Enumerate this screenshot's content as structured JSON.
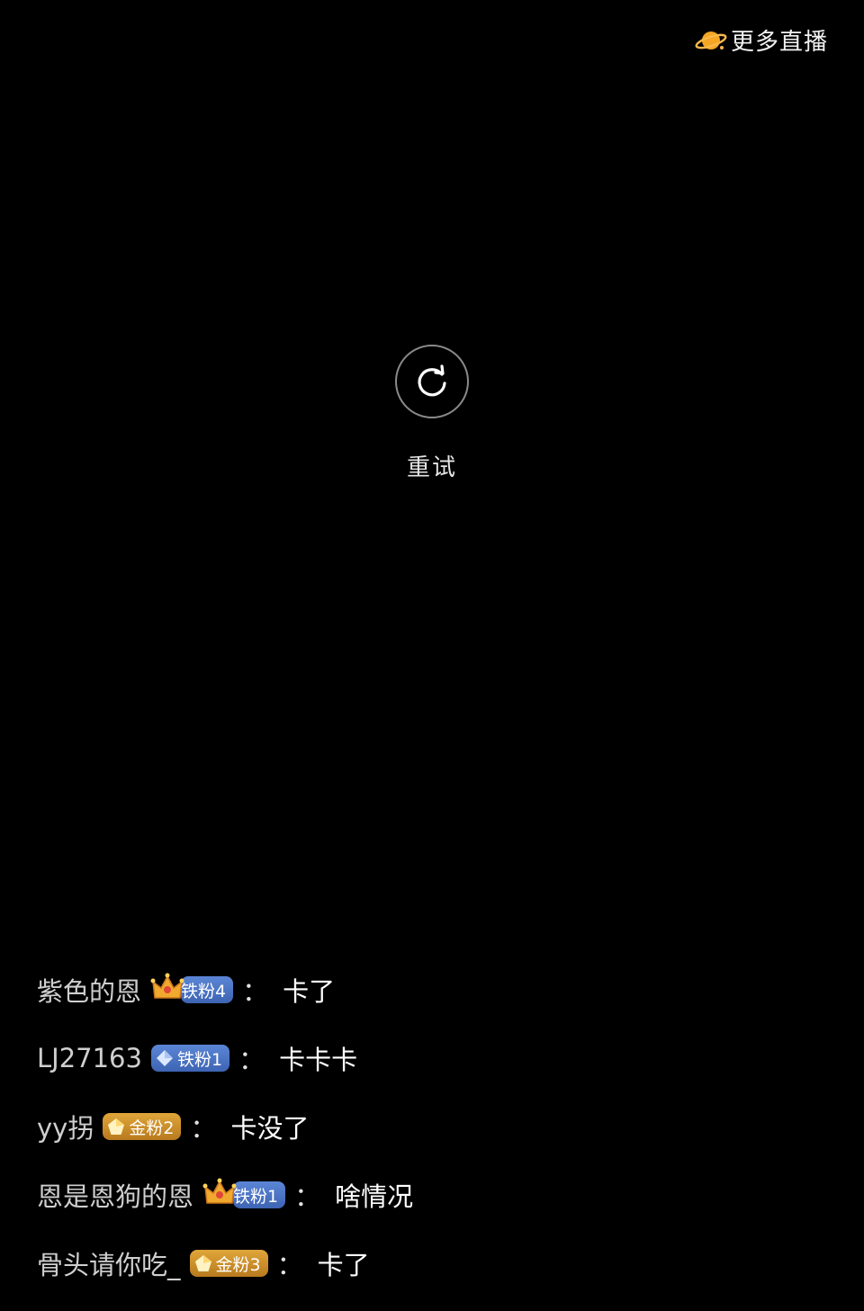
{
  "header": {
    "more_live_label": "更多直播",
    "more_live_icon": "planet-icon"
  },
  "player": {
    "retry_icon": "refresh-icon",
    "retry_label": "重试"
  },
  "chat": {
    "messages": [
      {
        "username": "紫色的恩",
        "badge_type": "iron",
        "badge_icon": "crown-icon",
        "badge_label": "铁粉4",
        "colon": "：",
        "text": "卡了"
      },
      {
        "username": "LJ27163",
        "badge_type": "iron",
        "badge_icon": "diamond-icon",
        "badge_label": "铁粉1",
        "colon": "：",
        "text": "卡卡卡"
      },
      {
        "username": "yy拐",
        "badge_type": "gold",
        "badge_icon": "pentagon-gem-icon",
        "badge_label": "金粉2",
        "colon": "：",
        "text": "卡没了"
      },
      {
        "username": "恩是恩狗的恩",
        "badge_type": "iron",
        "badge_icon": "crown-icon",
        "badge_label": "铁粉1",
        "colon": "：",
        "text": "啥情况"
      },
      {
        "username": "骨头请你吃_",
        "badge_type": "gold",
        "badge_icon": "pentagon-gem-icon",
        "badge_label": "金粉3",
        "colon": "：",
        "text": "卡了"
      }
    ]
  },
  "colors": {
    "background": "#000000",
    "iron_badge": "#4a73c4",
    "gold_badge": "#d0952e",
    "planet": "#f5a623"
  }
}
